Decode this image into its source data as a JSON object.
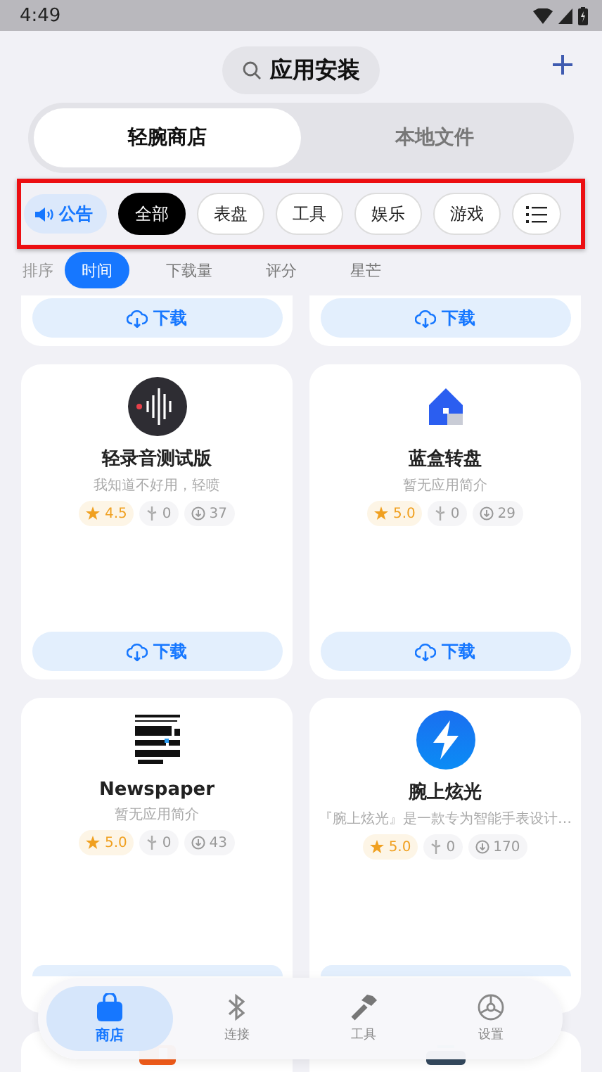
{
  "status_bar": {
    "time": "4:49"
  },
  "header": {
    "search": "应用安装"
  },
  "tabs": [
    {
      "label": "轻腕商店",
      "selected": true
    },
    {
      "label": "本地文件",
      "selected": false
    }
  ],
  "filters": {
    "announcement": "公告",
    "categories": [
      {
        "label": "全部",
        "selected": true
      },
      {
        "label": "表盘",
        "selected": false
      },
      {
        "label": "工具",
        "selected": false
      },
      {
        "label": "娱乐",
        "selected": false
      },
      {
        "label": "游戏",
        "selected": false
      }
    ]
  },
  "sort": {
    "label": "排序",
    "options": [
      {
        "label": "时间",
        "selected": true
      },
      {
        "label": "下载量",
        "selected": false
      },
      {
        "label": "评分",
        "selected": false
      },
      {
        "label": "星芒",
        "selected": false
      }
    ]
  },
  "top_row": [
    {
      "button": "下载"
    },
    {
      "button": "下载"
    }
  ],
  "apps": [
    {
      "kind": "recorder",
      "name": "轻录音测试版",
      "description": "我知道不好用，轻喷",
      "rating": "4.5",
      "likes": "0",
      "downloads": "37",
      "button": "下载"
    },
    {
      "kind": "house",
      "name": "蓝盒转盘",
      "description": "暂无应用简介",
      "rating": "5.0",
      "likes": "0",
      "downloads": "29",
      "button": "下载"
    },
    {
      "kind": "newspaper",
      "name": "Newspaper",
      "description": "暂无应用简介",
      "rating": "5.0",
      "likes": "0",
      "downloads": "43"
    },
    {
      "kind": "bolt",
      "name": "腕上炫光",
      "description": "『腕上炫光』是一款专为智能手表设计…",
      "rating": "5.0",
      "likes": "0",
      "downloads": "170"
    }
  ],
  "bottom_row": [
    {
      "kind": "orange"
    },
    {
      "kind": "slate"
    }
  ],
  "nav": [
    {
      "label": "商店",
      "kind": "bag",
      "selected": true
    },
    {
      "label": "连接",
      "kind": "bluetooth",
      "selected": false
    },
    {
      "label": "工具",
      "kind": "hammer",
      "selected": false
    },
    {
      "label": "设置",
      "kind": "gear",
      "selected": false
    }
  ]
}
